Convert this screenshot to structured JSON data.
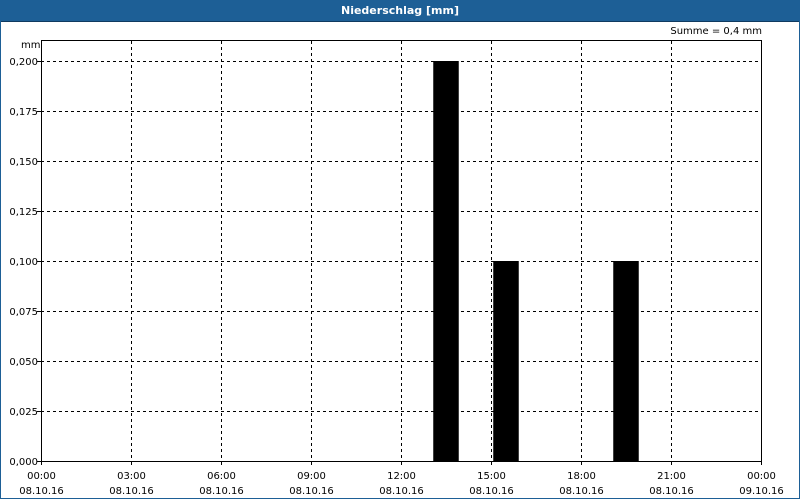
{
  "window": {
    "title": "Niederschlag [mm]"
  },
  "summary": {
    "text": "Summe = 0,4 mm"
  },
  "chart_data": {
    "type": "bar",
    "title": "Niederschlag [mm]",
    "ylabel": "mm",
    "ylim": [
      0,
      0.2
    ],
    "y_ticks": [
      "0,000",
      "0,025",
      "0,050",
      "0,075",
      "0,100",
      "0,125",
      "0,150",
      "0,175",
      "0,200"
    ],
    "x_range_hours": [
      0,
      24
    ],
    "x_ticks": [
      {
        "time": "00:00",
        "date": "08.10.16"
      },
      {
        "time": "03:00",
        "date": "08.10.16"
      },
      {
        "time": "06:00",
        "date": "08.10.16"
      },
      {
        "time": "09:00",
        "date": "08.10.16"
      },
      {
        "time": "12:00",
        "date": "08.10.16"
      },
      {
        "time": "15:00",
        "date": "08.10.16"
      },
      {
        "time": "18:00",
        "date": "08.10.16"
      },
      {
        "time": "21:00",
        "date": "08.10.16"
      },
      {
        "time": "00:00",
        "date": "09.10.16"
      }
    ],
    "bars": [
      {
        "start": "13:00",
        "end": "14:00",
        "value": 0.2
      },
      {
        "start": "15:00",
        "end": "16:00",
        "value": 0.1
      },
      {
        "start": "19:00",
        "end": "20:00",
        "value": 0.1
      }
    ],
    "bar_color": "#000000",
    "grid": true
  }
}
